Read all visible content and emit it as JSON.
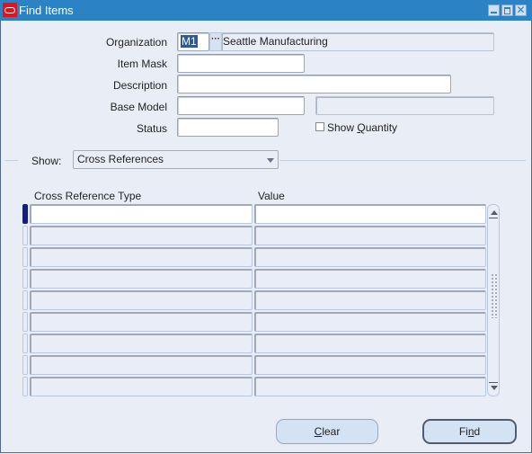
{
  "window": {
    "title": "Find Items",
    "controls": [
      "minimize",
      "maximize",
      "close"
    ],
    "close_glyph": "✕"
  },
  "form": {
    "organization": {
      "label": "Organization",
      "code": "M1",
      "lov_glyph": "···",
      "name": "Seattle Manufacturing"
    },
    "item_mask": {
      "label": "Item Mask",
      "value": ""
    },
    "description": {
      "label": "Description",
      "value": ""
    },
    "base_model": {
      "label": "Base Model",
      "value": "",
      "description": ""
    },
    "status": {
      "label": "Status",
      "value": ""
    },
    "show_quantity": {
      "label_pre": "Show ",
      "label_mnemonic": "Q",
      "label_post": "uantity",
      "checked": false
    }
  },
  "show": {
    "label": "Show:",
    "selected": "Cross References"
  },
  "grid": {
    "columns": [
      "Cross Reference Type",
      "Value"
    ],
    "rows": [
      {
        "type": "",
        "value": "",
        "active": true
      },
      {
        "type": "",
        "value": ""
      },
      {
        "type": "",
        "value": ""
      },
      {
        "type": "",
        "value": ""
      },
      {
        "type": "",
        "value": ""
      },
      {
        "type": "",
        "value": ""
      },
      {
        "type": "",
        "value": ""
      },
      {
        "type": "",
        "value": ""
      },
      {
        "type": "",
        "value": ""
      }
    ]
  },
  "buttons": {
    "clear": {
      "mnemonic": "C",
      "rest": "lear"
    },
    "find": {
      "pre": "Fi",
      "mnemonic": "n",
      "post": "d"
    }
  }
}
